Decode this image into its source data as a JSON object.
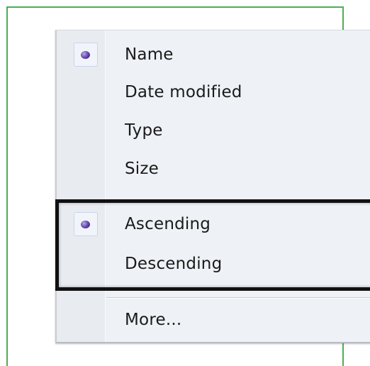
{
  "menu": {
    "sort_by_items": [
      {
        "label": "Name",
        "selected": true
      },
      {
        "label": "Date modified",
        "selected": false
      },
      {
        "label": "Type",
        "selected": false
      },
      {
        "label": "Size",
        "selected": false
      }
    ],
    "order_items": [
      {
        "label": "Ascending",
        "selected": true
      },
      {
        "label": "Descending",
        "selected": false
      }
    ],
    "more_label": "More..."
  },
  "colors": {
    "guide_lines": "#4caf50",
    "highlight_border": "#111111",
    "radio_dot": "#5c3ea6",
    "menu_background": "#eef1f5"
  },
  "icons": {
    "selected_marker": "radio-bullet-icon"
  }
}
